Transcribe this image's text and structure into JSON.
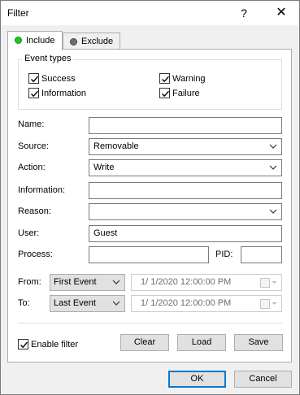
{
  "window": {
    "title": "Filter",
    "help_glyph": "?",
    "close_glyph": "✕"
  },
  "tabs": [
    {
      "label": "Include",
      "dot_color": "#22c422"
    },
    {
      "label": "Exclude",
      "dot_color": "#6e6e6e"
    }
  ],
  "event_types": {
    "title": "Event types",
    "items": [
      {
        "label": "Success",
        "checked": true
      },
      {
        "label": "Information",
        "checked": true
      },
      {
        "label": "Warning",
        "checked": true
      },
      {
        "label": "Failure",
        "checked": true
      }
    ]
  },
  "form": {
    "name_label": "Name:",
    "name_value": "",
    "source_label": "Source:",
    "source_value": "Removable",
    "action_label": "Action:",
    "action_value": "Write",
    "information_label": "Information:",
    "information_value": "",
    "reason_label": "Reason:",
    "reason_value": "",
    "user_label": "User:",
    "user_value": "Guest",
    "process_label": "Process:",
    "process_value": "",
    "pid_label": "PID:",
    "pid_value": "",
    "from_label": "From:",
    "from_select": "First Event",
    "from_datetime": "1/  1/2020 12:00:00 PM",
    "to_label": "To:",
    "to_select": "Last Event",
    "to_datetime": "1/  1/2020 12:00:00 PM"
  },
  "footer": {
    "enable_filter_label": "Enable filter",
    "enable_filter_checked": true,
    "clear_label": "Clear",
    "load_label": "Load",
    "save_label": "Save"
  },
  "dialog_buttons": {
    "ok_label": "OK",
    "cancel_label": "Cancel"
  }
}
